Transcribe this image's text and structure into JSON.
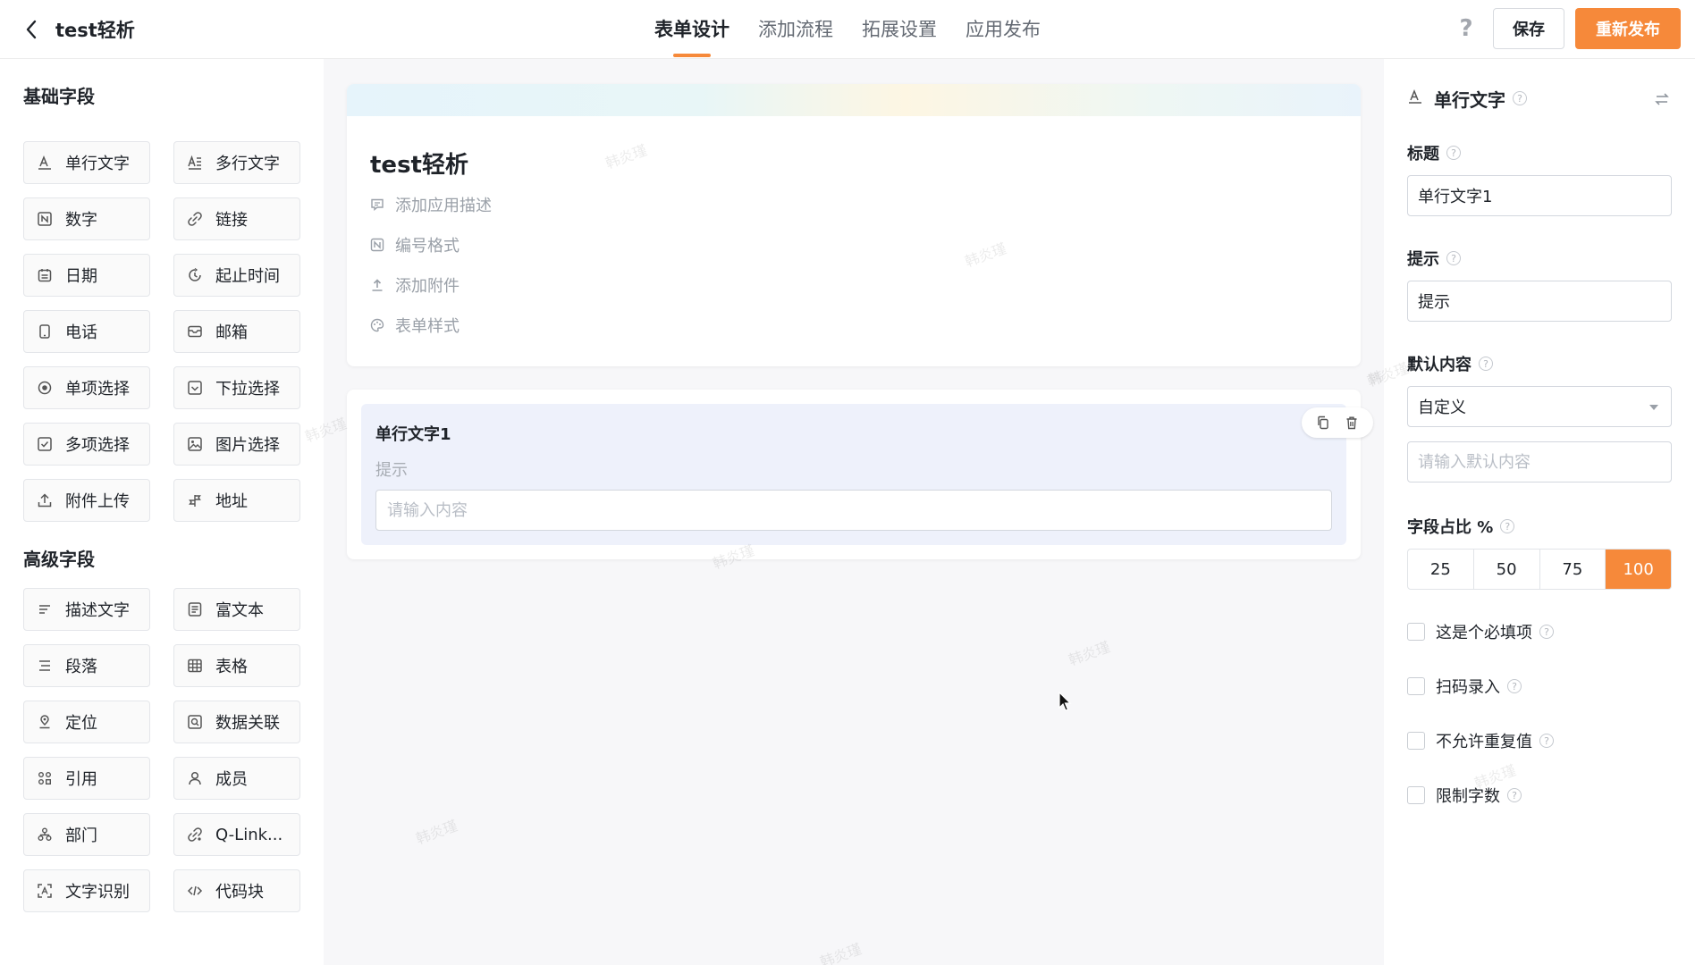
{
  "app": {
    "title": "test轻析"
  },
  "tabs": [
    {
      "label": "表单设计",
      "active": true
    },
    {
      "label": "添加流程",
      "active": false
    },
    {
      "label": "拓展设置",
      "active": false
    },
    {
      "label": "应用发布",
      "active": false
    }
  ],
  "header": {
    "help_icon": "?",
    "save_label": "保存",
    "publish_label": "重新发布"
  },
  "sidebar": {
    "basic_title": "基础字段",
    "basic_fields": [
      {
        "label": "单行文字",
        "icon": "text-icon"
      },
      {
        "label": "多行文字",
        "icon": "multiline-text-icon"
      },
      {
        "label": "数字",
        "icon": "number-icon"
      },
      {
        "label": "链接",
        "icon": "link-icon"
      },
      {
        "label": "日期",
        "icon": "calendar-icon"
      },
      {
        "label": "起止时间",
        "icon": "time-range-icon"
      },
      {
        "label": "电话",
        "icon": "phone-icon"
      },
      {
        "label": "邮箱",
        "icon": "mail-icon"
      },
      {
        "label": "单项选择",
        "icon": "radio-icon"
      },
      {
        "label": "下拉选择",
        "icon": "dropdown-icon"
      },
      {
        "label": "多项选择",
        "icon": "checkbox-icon"
      },
      {
        "label": "图片选择",
        "icon": "image-icon"
      },
      {
        "label": "附件上传",
        "icon": "upload-icon"
      },
      {
        "label": "地址",
        "icon": "address-icon"
      }
    ],
    "advanced_title": "高级字段",
    "advanced_fields": [
      {
        "label": "描述文字",
        "icon": "description-icon"
      },
      {
        "label": "富文本",
        "icon": "rich-text-icon"
      },
      {
        "label": "段落",
        "icon": "paragraph-icon"
      },
      {
        "label": "表格",
        "icon": "table-icon"
      },
      {
        "label": "定位",
        "icon": "location-icon"
      },
      {
        "label": "数据关联",
        "icon": "data-link-icon"
      },
      {
        "label": "引用",
        "icon": "reference-icon"
      },
      {
        "label": "成员",
        "icon": "member-icon"
      },
      {
        "label": "部门",
        "icon": "department-icon"
      },
      {
        "label": "Q-Link...",
        "icon": "qlink-icon"
      },
      {
        "label": "文字识别",
        "icon": "ocr-icon"
      },
      {
        "label": "代码块",
        "icon": "code-icon"
      }
    ]
  },
  "form": {
    "title": "test轻析",
    "meta": [
      {
        "label": "添加应用描述",
        "icon": "comment-icon"
      },
      {
        "label": "编号格式",
        "icon": "number-format-icon"
      },
      {
        "label": "添加附件",
        "icon": "attachment-upload-icon"
      },
      {
        "label": "表单样式",
        "icon": "palette-icon"
      }
    ],
    "field": {
      "title": "单行文字1",
      "hint": "提示",
      "placeholder": "请输入内容"
    },
    "watermark": "韩炎瑾"
  },
  "panel": {
    "header": "单行文字",
    "title_label": "标题",
    "title_value": "单行文字1",
    "hint_label": "提示",
    "hint_value": "提示",
    "default_label": "默认内容",
    "default_select": "自定义",
    "default_placeholder": "请输入默认内容",
    "ratio_label": "字段占比 %",
    "ratio_options": [
      "25",
      "50",
      "75",
      "100"
    ],
    "ratio_selected": "100",
    "checkboxes": [
      {
        "label": "这是个必填项",
        "checked": false
      },
      {
        "label": "扫码录入",
        "checked": false
      },
      {
        "label": "不允许重复值",
        "checked": false
      },
      {
        "label": "限制字数",
        "checked": false
      }
    ]
  },
  "colors": {
    "accent": "#f6893a",
    "selected_field_bg": "#eef1fb",
    "canvas_bg": "#f7f7f9"
  }
}
